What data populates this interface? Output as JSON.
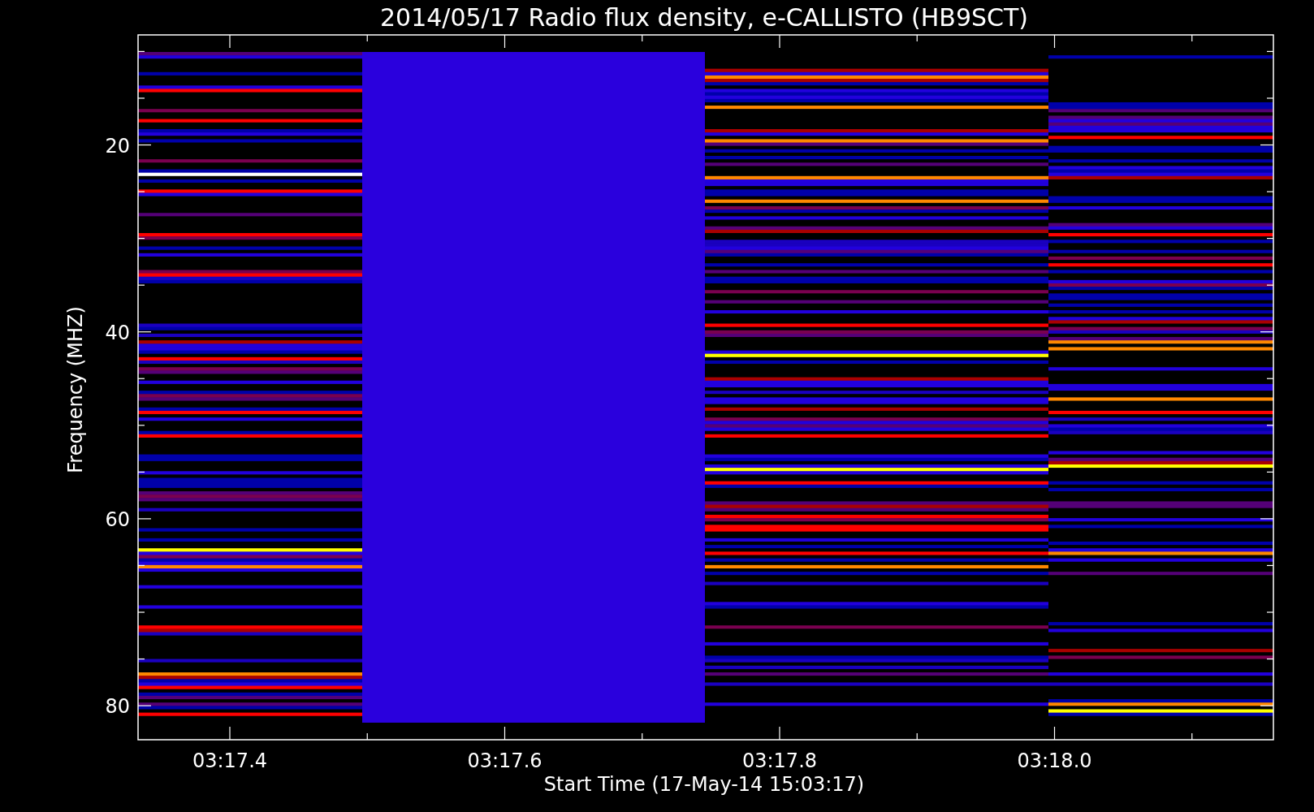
{
  "title": "2014/05/17  Radio flux density, e-CALLISTO (HB9SCT)",
  "y_axis": {
    "label": "Frequency (MHZ)",
    "ticks": [
      "20",
      "40",
      "60",
      "80"
    ]
  },
  "x_axis": {
    "label": "Start Time (17-May-14 15:03:17)",
    "ticks": [
      "03:17.4",
      "03:17.6",
      "03:17.8",
      "03:18.0"
    ]
  }
}
